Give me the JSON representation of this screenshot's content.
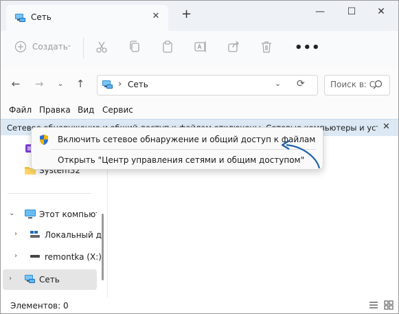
{
  "window": {
    "tab_title": "Сеть",
    "tab_close": "✕",
    "new_tab": "+",
    "minimize": "—",
    "maximize": "☐",
    "close": "✕"
  },
  "toolbar": {
    "create_label": "Создать",
    "create_chevron": "⌄",
    "icons": [
      "cut-icon",
      "copy-icon",
      "paste-icon",
      "rename-icon",
      "share-icon",
      "delete-icon"
    ],
    "more": "•••"
  },
  "nav": {
    "back": "←",
    "forward": "→",
    "recent": "⌄",
    "up": "↑"
  },
  "address": {
    "separator": "›",
    "path": "Сеть",
    "dropdown": "⌄",
    "refresh": "⟳"
  },
  "search": {
    "placeholder": "Поиск в: С"
  },
  "menubar": {
    "items": [
      "Файл",
      "Правка",
      "Вид",
      "Сервис"
    ]
  },
  "infobar": {
    "text": "Сетевое обнаружение и общий доступ к файлам отключены. Сетевые компьютеры и устройства не видны. Щелкните, чтобы изменить...",
    "close": "✕"
  },
  "context_menu": {
    "items": [
      "Включить сетевое обнаружение и общий доступ к файлам",
      "Открыть \"Центр управления сетями и общим доступом\""
    ]
  },
  "sidebar": {
    "items": [
      {
        "label": "",
        "chevron": ""
      },
      {
        "label": "System32",
        "chevron": ""
      },
      {
        "label": "Этот компьютер",
        "chevron": "⌄"
      },
      {
        "label": "Локальный диск (C:)",
        "chevron": "›"
      },
      {
        "label": "remontka (X:)",
        "chevron": "›"
      },
      {
        "label": "Сеть",
        "chevron": "›"
      }
    ]
  },
  "status": {
    "items_count": "Элементов: 0"
  },
  "colors": {
    "accent": "#0067c0",
    "infobar": "#dce9f5",
    "selected": "#e5e5e5"
  }
}
